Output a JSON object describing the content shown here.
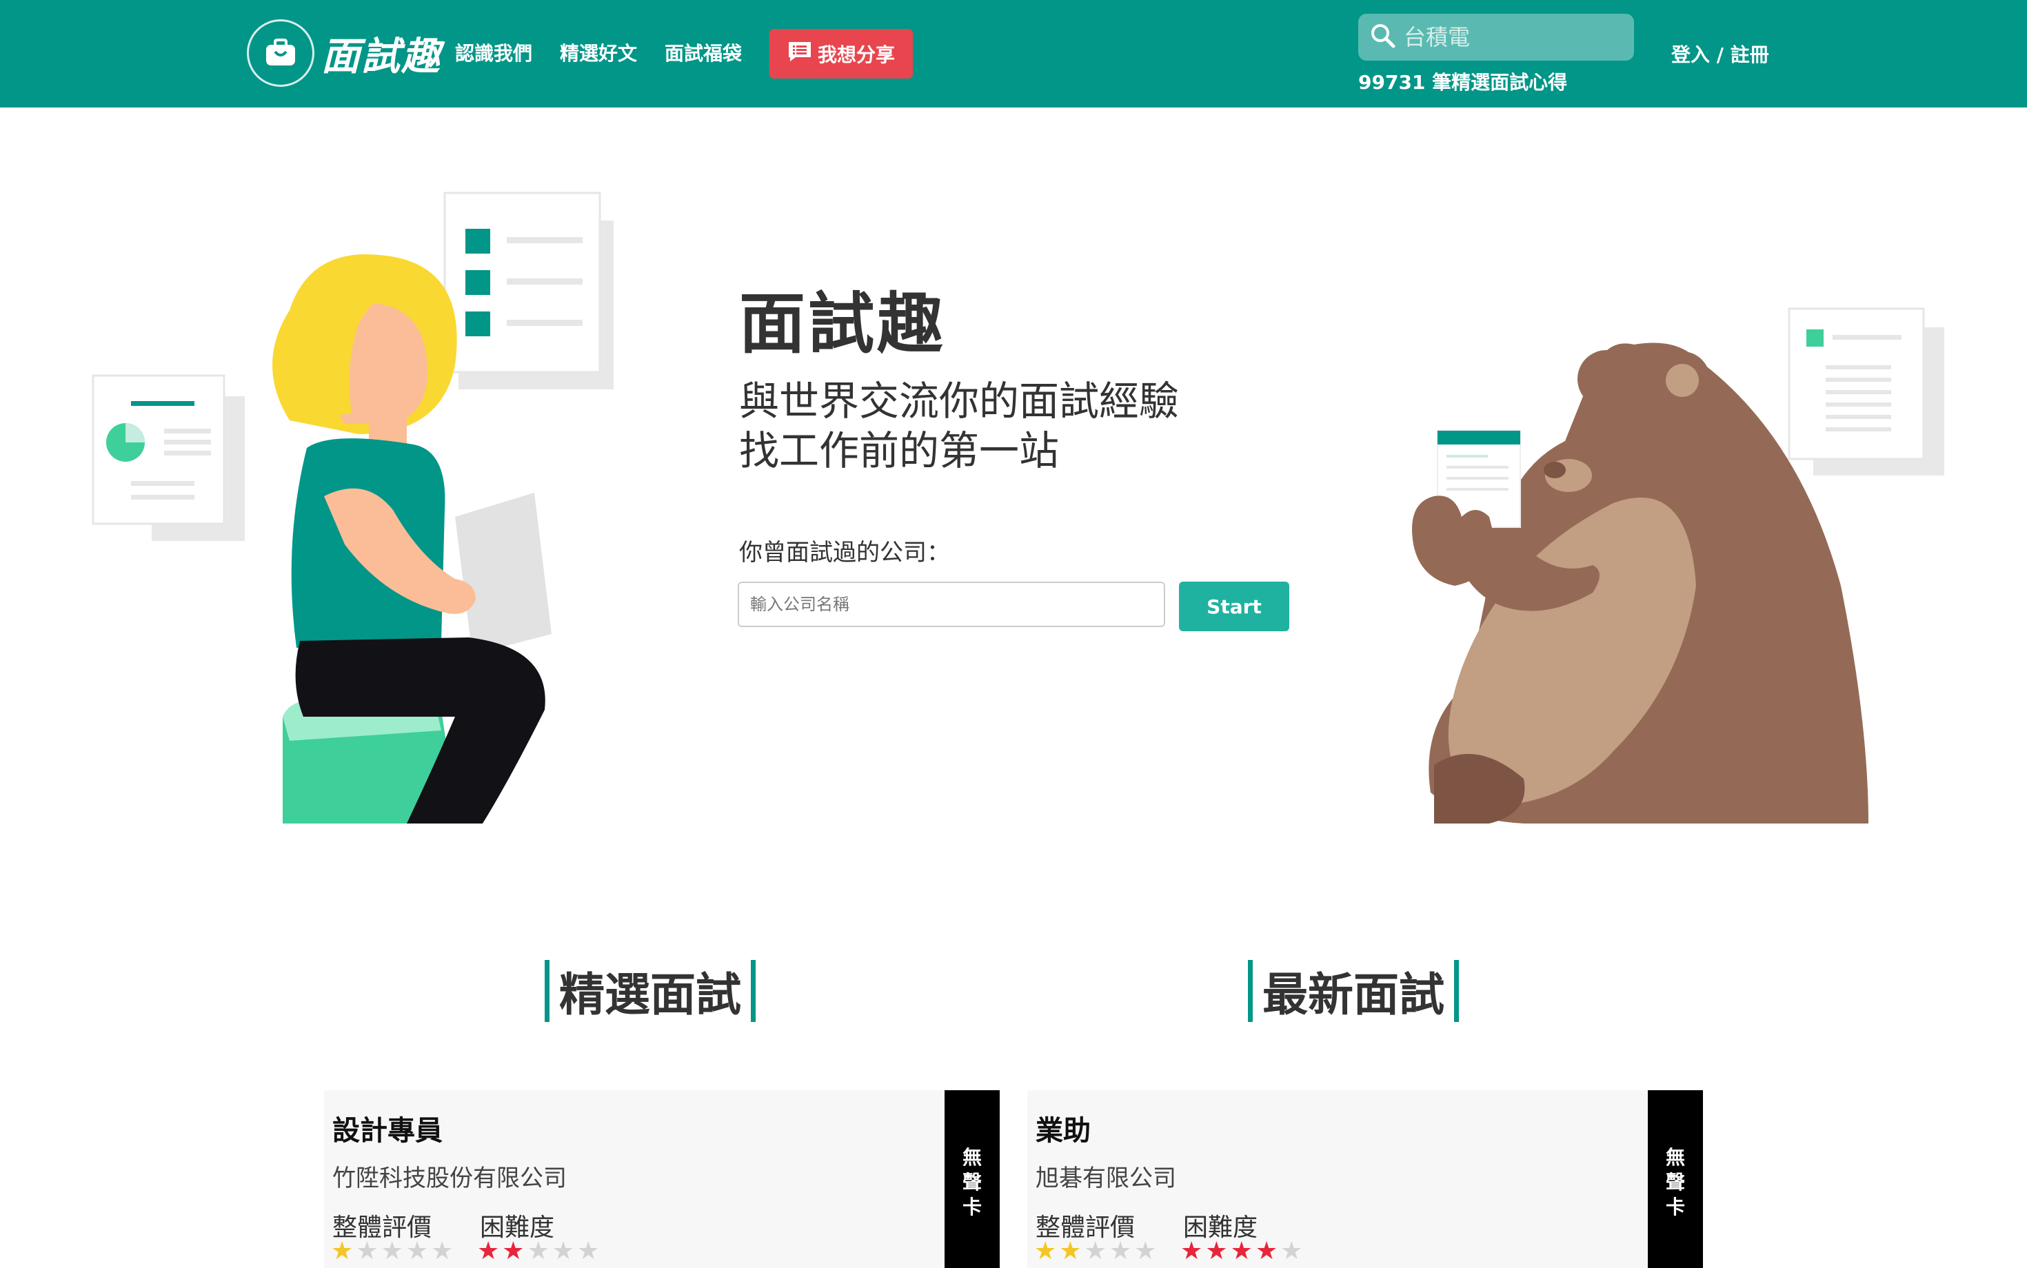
{
  "navbar": {
    "logo_text": "面試趣",
    "links": [
      "認識我們",
      "精選好文",
      "面試福袋"
    ],
    "share_label": "我想分享",
    "search_placeholder": "台積電",
    "interview_count": "99731 筆精選面試心得",
    "login_label": "登入 / 註冊"
  },
  "hero": {
    "title": "面試趣",
    "subtitle_line1": "與世界交流你的面試經驗",
    "subtitle_line2": "找工作前的第一站",
    "company_label": "你曾面試過的公司：",
    "company_placeholder": "輸入公司名稱",
    "start_label": "Start"
  },
  "sections": {
    "featured_title": "精選面試",
    "latest_title": "最新面試"
  },
  "cards": {
    "featured": {
      "job": "設計專員",
      "company": "竹陞科技股份有限公司",
      "overall_label": "整體評價",
      "difficulty_label": "困難度",
      "overall_rating": 1,
      "difficulty_rating": 2,
      "side_text": "無聲卡"
    },
    "latest": {
      "job": "業助",
      "company": "旭碁有限公司",
      "overall_label": "整體評價",
      "difficulty_label": "困難度",
      "overall_rating": 2,
      "difficulty_rating": 4,
      "side_text": "無聲卡"
    }
  },
  "colors": {
    "brand": "#029688",
    "share": "#e8454f",
    "start": "#20b2a0",
    "star_yellow": "#f3c623",
    "star_red": "#e8253a"
  }
}
